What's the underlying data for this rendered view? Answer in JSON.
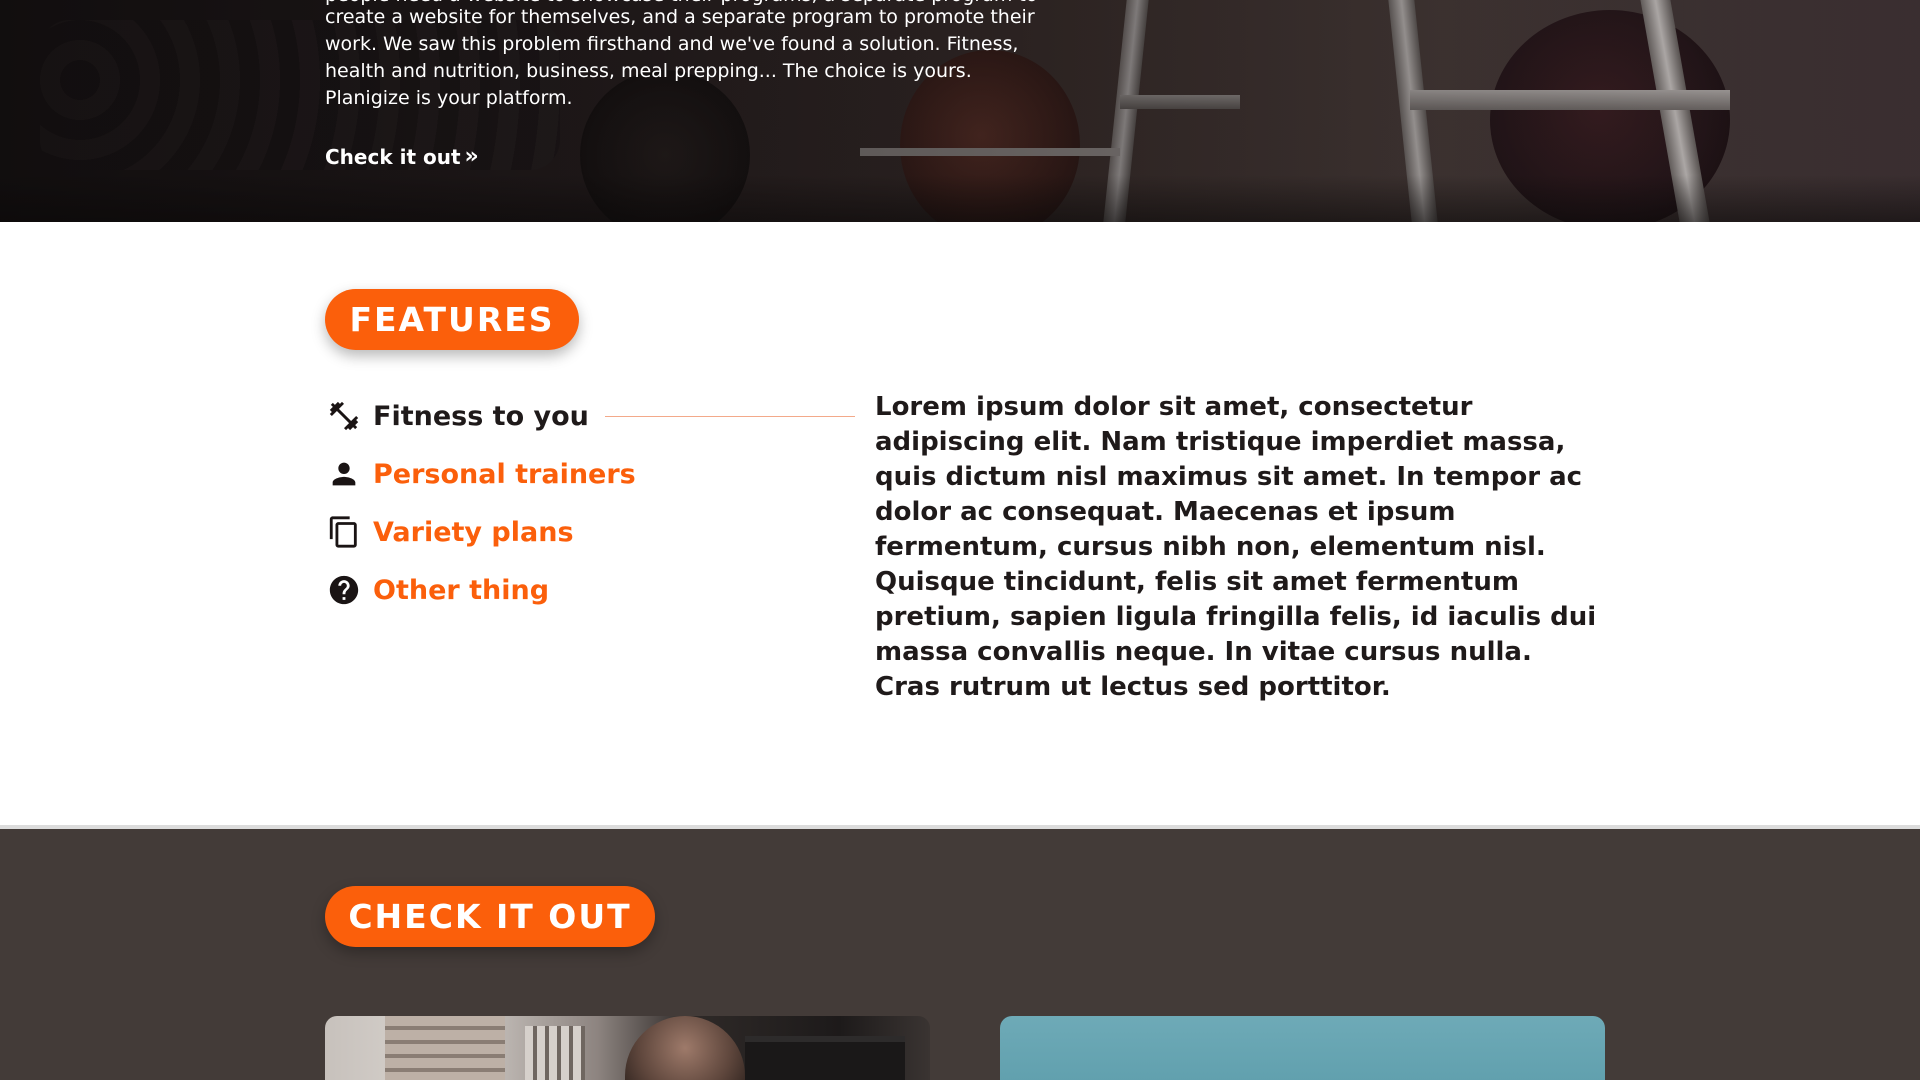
{
  "hero": {
    "clipped_line": "people need a website to showcase their programs, a separate program to",
    "body": "create a website for themselves, and a separate program to promote their work. We saw this problem firsthand and we've found a solution. Fitness, health and nutrition, business, meal prepping... The choice is yours. Planigize is your platform.",
    "cta_label": "Check it out",
    "cta_icon": "double-chevron-right-icon"
  },
  "features": {
    "heading": "FEATURES",
    "items": [
      {
        "label": "Fitness to you",
        "icon": "dumbbell-icon",
        "active": true
      },
      {
        "label": "Personal trainers",
        "icon": "person-icon",
        "active": false
      },
      {
        "label": "Variety plans",
        "icon": "copy-icon",
        "active": false
      },
      {
        "label": "Other thing",
        "icon": "help-circle-icon",
        "active": false
      }
    ],
    "description": "Lorem ipsum dolor sit amet, consectetur adipiscing elit. Nam tristique imperdiet massa, quis dictum nisl maximus sit amet. In tempor ac dolor ac consequat. Maecenas et ipsum fermentum, cursus nibh non, elementum nisl. Quisque tincidunt, felis sit amet fermentum pretium, sapien ligula fringilla felis, id iaculis dui massa convallis neque. In vitae cursus nulla. Cras rutrum ut lectus sed porttitor."
  },
  "check_it_out": {
    "heading": "CHECK IT OUT"
  },
  "colors": {
    "accent": "#fb5f0b",
    "dark_section": "#433b38",
    "text_dark": "#1f1a1a",
    "rule": "#f3a98a"
  }
}
